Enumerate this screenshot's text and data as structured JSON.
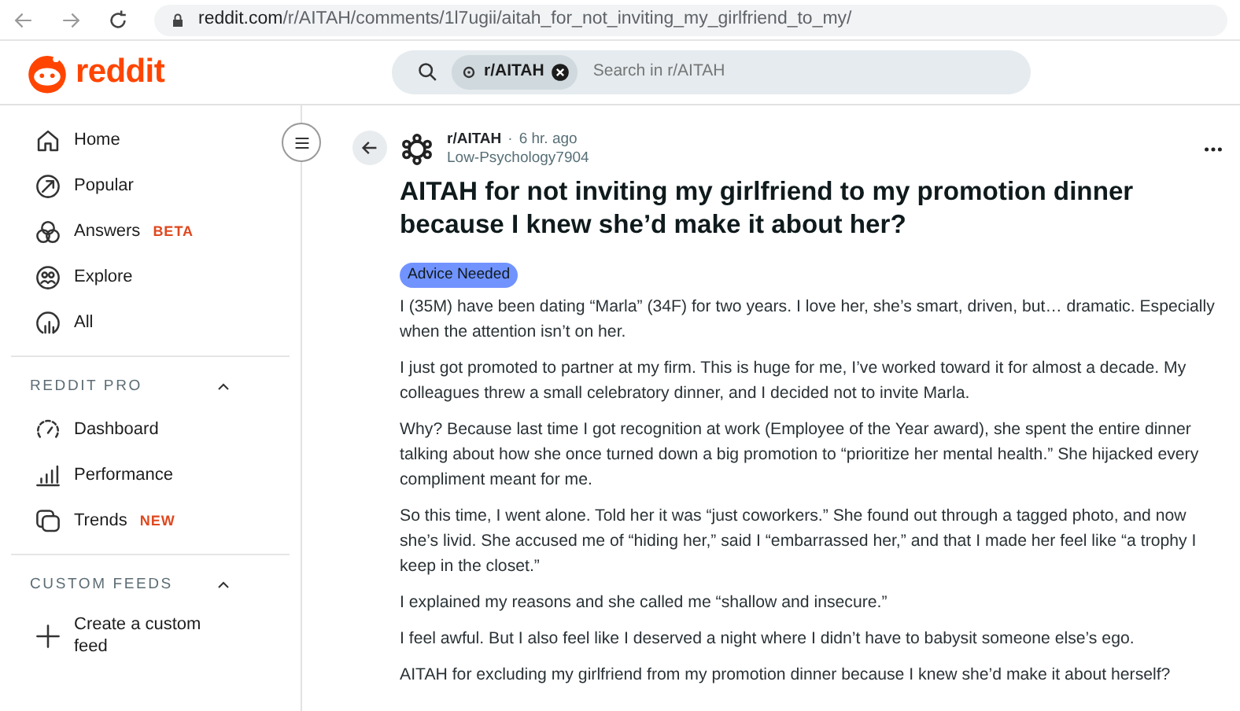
{
  "browser": {
    "url_host": "reddit.com",
    "url_path": "/r/AITAH/comments/1l7ugii/aitah_for_not_inviting_my_girlfriend_to_my/"
  },
  "header": {
    "logo_text": "reddit",
    "search_chip": "r/AITAH",
    "search_placeholder": "Search in r/AITAH"
  },
  "sidebar": {
    "items": [
      {
        "label": "Home"
      },
      {
        "label": "Popular"
      },
      {
        "label": "Answers",
        "tag": "BETA"
      },
      {
        "label": "Explore"
      },
      {
        "label": "All"
      }
    ],
    "sections": [
      {
        "title": "REDDIT PRO",
        "expanded": true,
        "items": [
          {
            "label": "Dashboard"
          },
          {
            "label": "Performance"
          },
          {
            "label": "Trends",
            "tag": "NEW"
          }
        ]
      },
      {
        "title": "CUSTOM FEEDS",
        "expanded": true,
        "items": [
          {
            "label": "Create a custom feed"
          }
        ]
      }
    ]
  },
  "post": {
    "subreddit": "r/AITAH",
    "separator": "·",
    "time": "6 hr. ago",
    "author": "Low-Psychology7904",
    "title": "AITAH for not inviting my girlfriend to my promotion dinner because I knew she’d make it about her?",
    "flair": "Advice Needed",
    "paragraphs": [
      "I (35M) have been dating “Marla” (34F) for two years. I love her, she’s smart, driven, but… dramatic. Especially when the attention isn’t on her.",
      "I just got promoted to partner at my firm. This is huge for me, I’ve worked toward it for almost a decade. My colleagues threw a small celebratory dinner, and I decided not to invite Marla.",
      "Why? Because last time I got recognition at work (Employee of the Year award), she spent the entire dinner talking about how she once turned down a big promotion to “prioritize her mental health.” She hijacked every compliment meant for me.",
      "So this time, I went alone. Told her it was “just coworkers.” She found out through a tagged photo, and now she’s livid. She accused me of “hiding her,” said I “embarrassed her,” and that I made her feel like “a trophy I keep in the closet.”",
      "I explained my reasons and she called me “shallow and insecure.”",
      "I feel awful. But I also feel like I deserved a night where I didn’t have to babysit someone else’s ego.",
      "AITAH for excluding my girlfriend from my promotion dinner because I knew she’d make it about herself?"
    ]
  }
}
